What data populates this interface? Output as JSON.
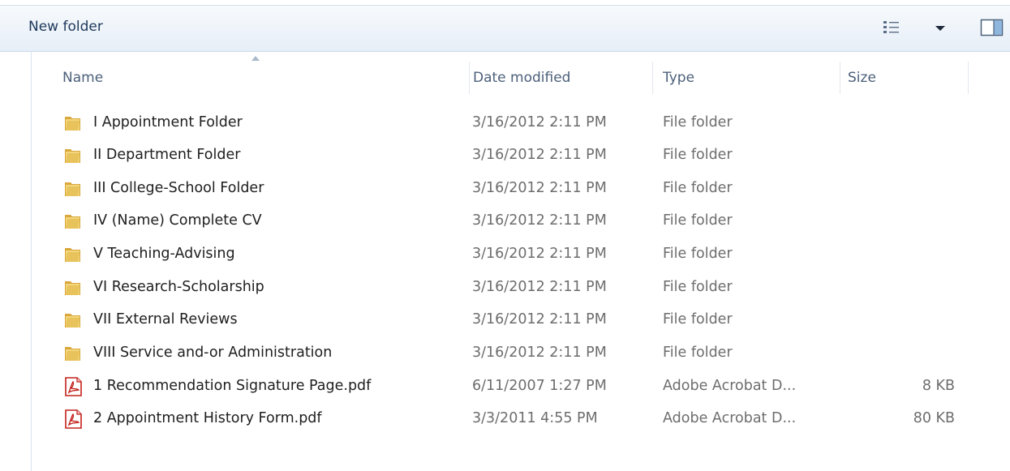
{
  "toolbar": {
    "new_folder_label": "New folder"
  },
  "columns": {
    "name": "Name",
    "date_modified": "Date modified",
    "type": "Type",
    "size": "Size"
  },
  "files": [
    {
      "name": "I Appointment Folder",
      "date": "3/16/2012 2:11 PM",
      "type": "File folder",
      "size": "",
      "icon": "folder-icon"
    },
    {
      "name": "II Department Folder",
      "date": "3/16/2012 2:11 PM",
      "type": "File folder",
      "size": "",
      "icon": "folder-icon"
    },
    {
      "name": "III College-School Folder",
      "date": "3/16/2012 2:11 PM",
      "type": "File folder",
      "size": "",
      "icon": "folder-icon"
    },
    {
      "name": "IV (Name) Complete CV",
      "date": "3/16/2012 2:11 PM",
      "type": "File folder",
      "size": "",
      "icon": "folder-icon"
    },
    {
      "name": "V Teaching-Advising",
      "date": "3/16/2012 2:11 PM",
      "type": "File folder",
      "size": "",
      "icon": "folder-icon"
    },
    {
      "name": "VI Research-Scholarship",
      "date": "3/16/2012 2:11 PM",
      "type": "File folder",
      "size": "",
      "icon": "folder-icon"
    },
    {
      "name": "VII External Reviews",
      "date": "3/16/2012 2:11 PM",
      "type": "File folder",
      "size": "",
      "icon": "folder-icon"
    },
    {
      "name": "VIII Service and-or Administration",
      "date": "3/16/2012 2:11 PM",
      "type": "File folder",
      "size": "",
      "icon": "folder-icon"
    },
    {
      "name": "1 Recommendation Signature Page.pdf",
      "date": "6/11/2007 1:27 PM",
      "type": "Adobe Acrobat D...",
      "size": "8 KB",
      "icon": "pdf-icon"
    },
    {
      "name": "2 Appointment History Form.pdf",
      "date": "3/3/2011 4:55 PM",
      "type": "Adobe Acrobat D...",
      "size": "80 KB",
      "icon": "pdf-icon"
    }
  ],
  "colors": {
    "toolbar_text": "#1e395b",
    "header_text": "#4c607a",
    "meta_text": "#6d6d6d",
    "folder_yellow": "#e8c25a",
    "pdf_red": "#c4201c"
  }
}
